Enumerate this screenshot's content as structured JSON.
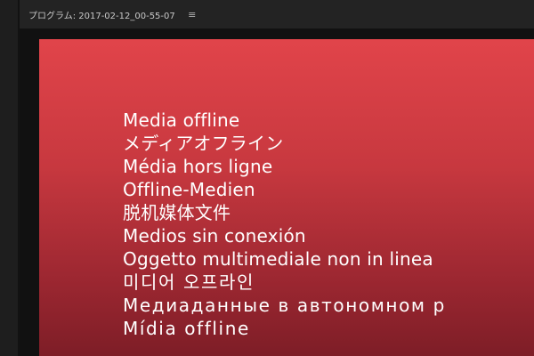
{
  "panel": {
    "title": "プログラム: 2017-02-12_00-55-07",
    "menu_icon": "≡"
  },
  "viewer": {
    "background_color": "#111111",
    "offline_gradient_top": "#e1444a",
    "offline_gradient_bottom": "#7c1d26",
    "offline_messages": [
      "Media offline",
      "メディアオフライン",
      "Média hors ligne",
      "Offline-Medien",
      "脱机媒体文件",
      "Medios sin conexión",
      "Oggetto multimediale non in linea",
      "미디어 오프라인",
      "Медиаданные в автономном р",
      "Mídia offline"
    ]
  }
}
